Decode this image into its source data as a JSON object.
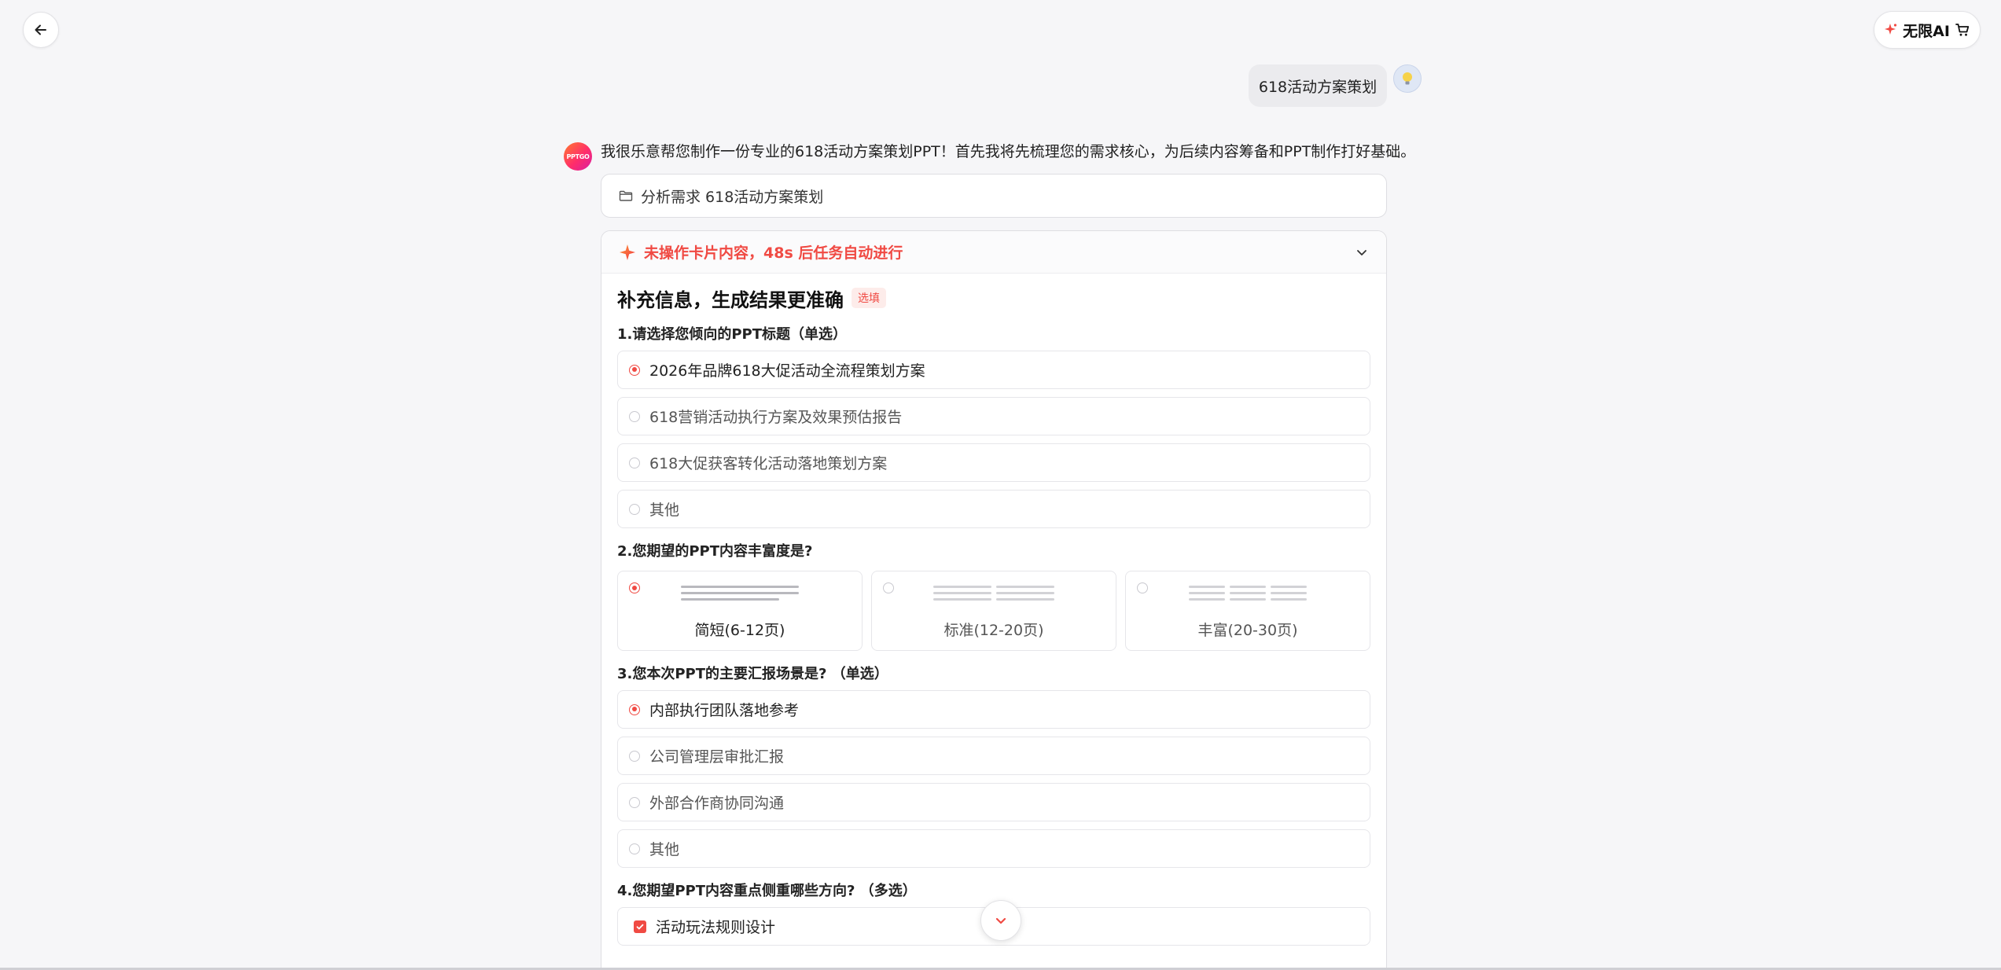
{
  "header": {
    "promo_label": "无限AI",
    "promo_icon": "sparkle-icon",
    "cart_icon": "cart-icon"
  },
  "chat": {
    "user_message": "618活动方案策划",
    "bot_avatar_text": "PPTGO",
    "bot_intro": "我很乐意帮您制作一份专业的618活动方案策划PPT！首先我将先梳理您的需求核心，为后续内容筹备和PPT制作打好基础。",
    "analysis_label": "分析需求 618活动方案策划"
  },
  "card": {
    "warning": "未操作卡片内容，48s 后任务自动进行",
    "title": "补充信息，生成结果更准确",
    "optional_tag": "选填",
    "q1": {
      "label": "1.请选择您倾向的PPT标题（单选）",
      "options": [
        "2026年品牌618大促活动全流程策划方案",
        "618营销活动执行方案及效果预估报告",
        "618大促获客转化活动落地策划方案",
        "其他"
      ],
      "selected": 0
    },
    "q2": {
      "label": "2.您期望的PPT内容丰富度是?",
      "options": [
        "简短(6-12页)",
        "标准(12-20页)",
        "丰富(20-30页)"
      ],
      "selected": 0
    },
    "q3": {
      "label": "3.您本次PPT的主要汇报场景是? （单选）",
      "options": [
        "内部执行团队落地参考",
        "公司管理层审批汇报",
        "外部合作商协同沟通",
        "其他"
      ],
      "selected": 0
    },
    "q4": {
      "label": "4.您期望PPT内容重点侧重哪些方向? （多选）",
      "options": [
        "活动玩法规则设计"
      ]
    }
  },
  "colors": {
    "accent": "#f04a43",
    "background": "#f6f6f8"
  }
}
